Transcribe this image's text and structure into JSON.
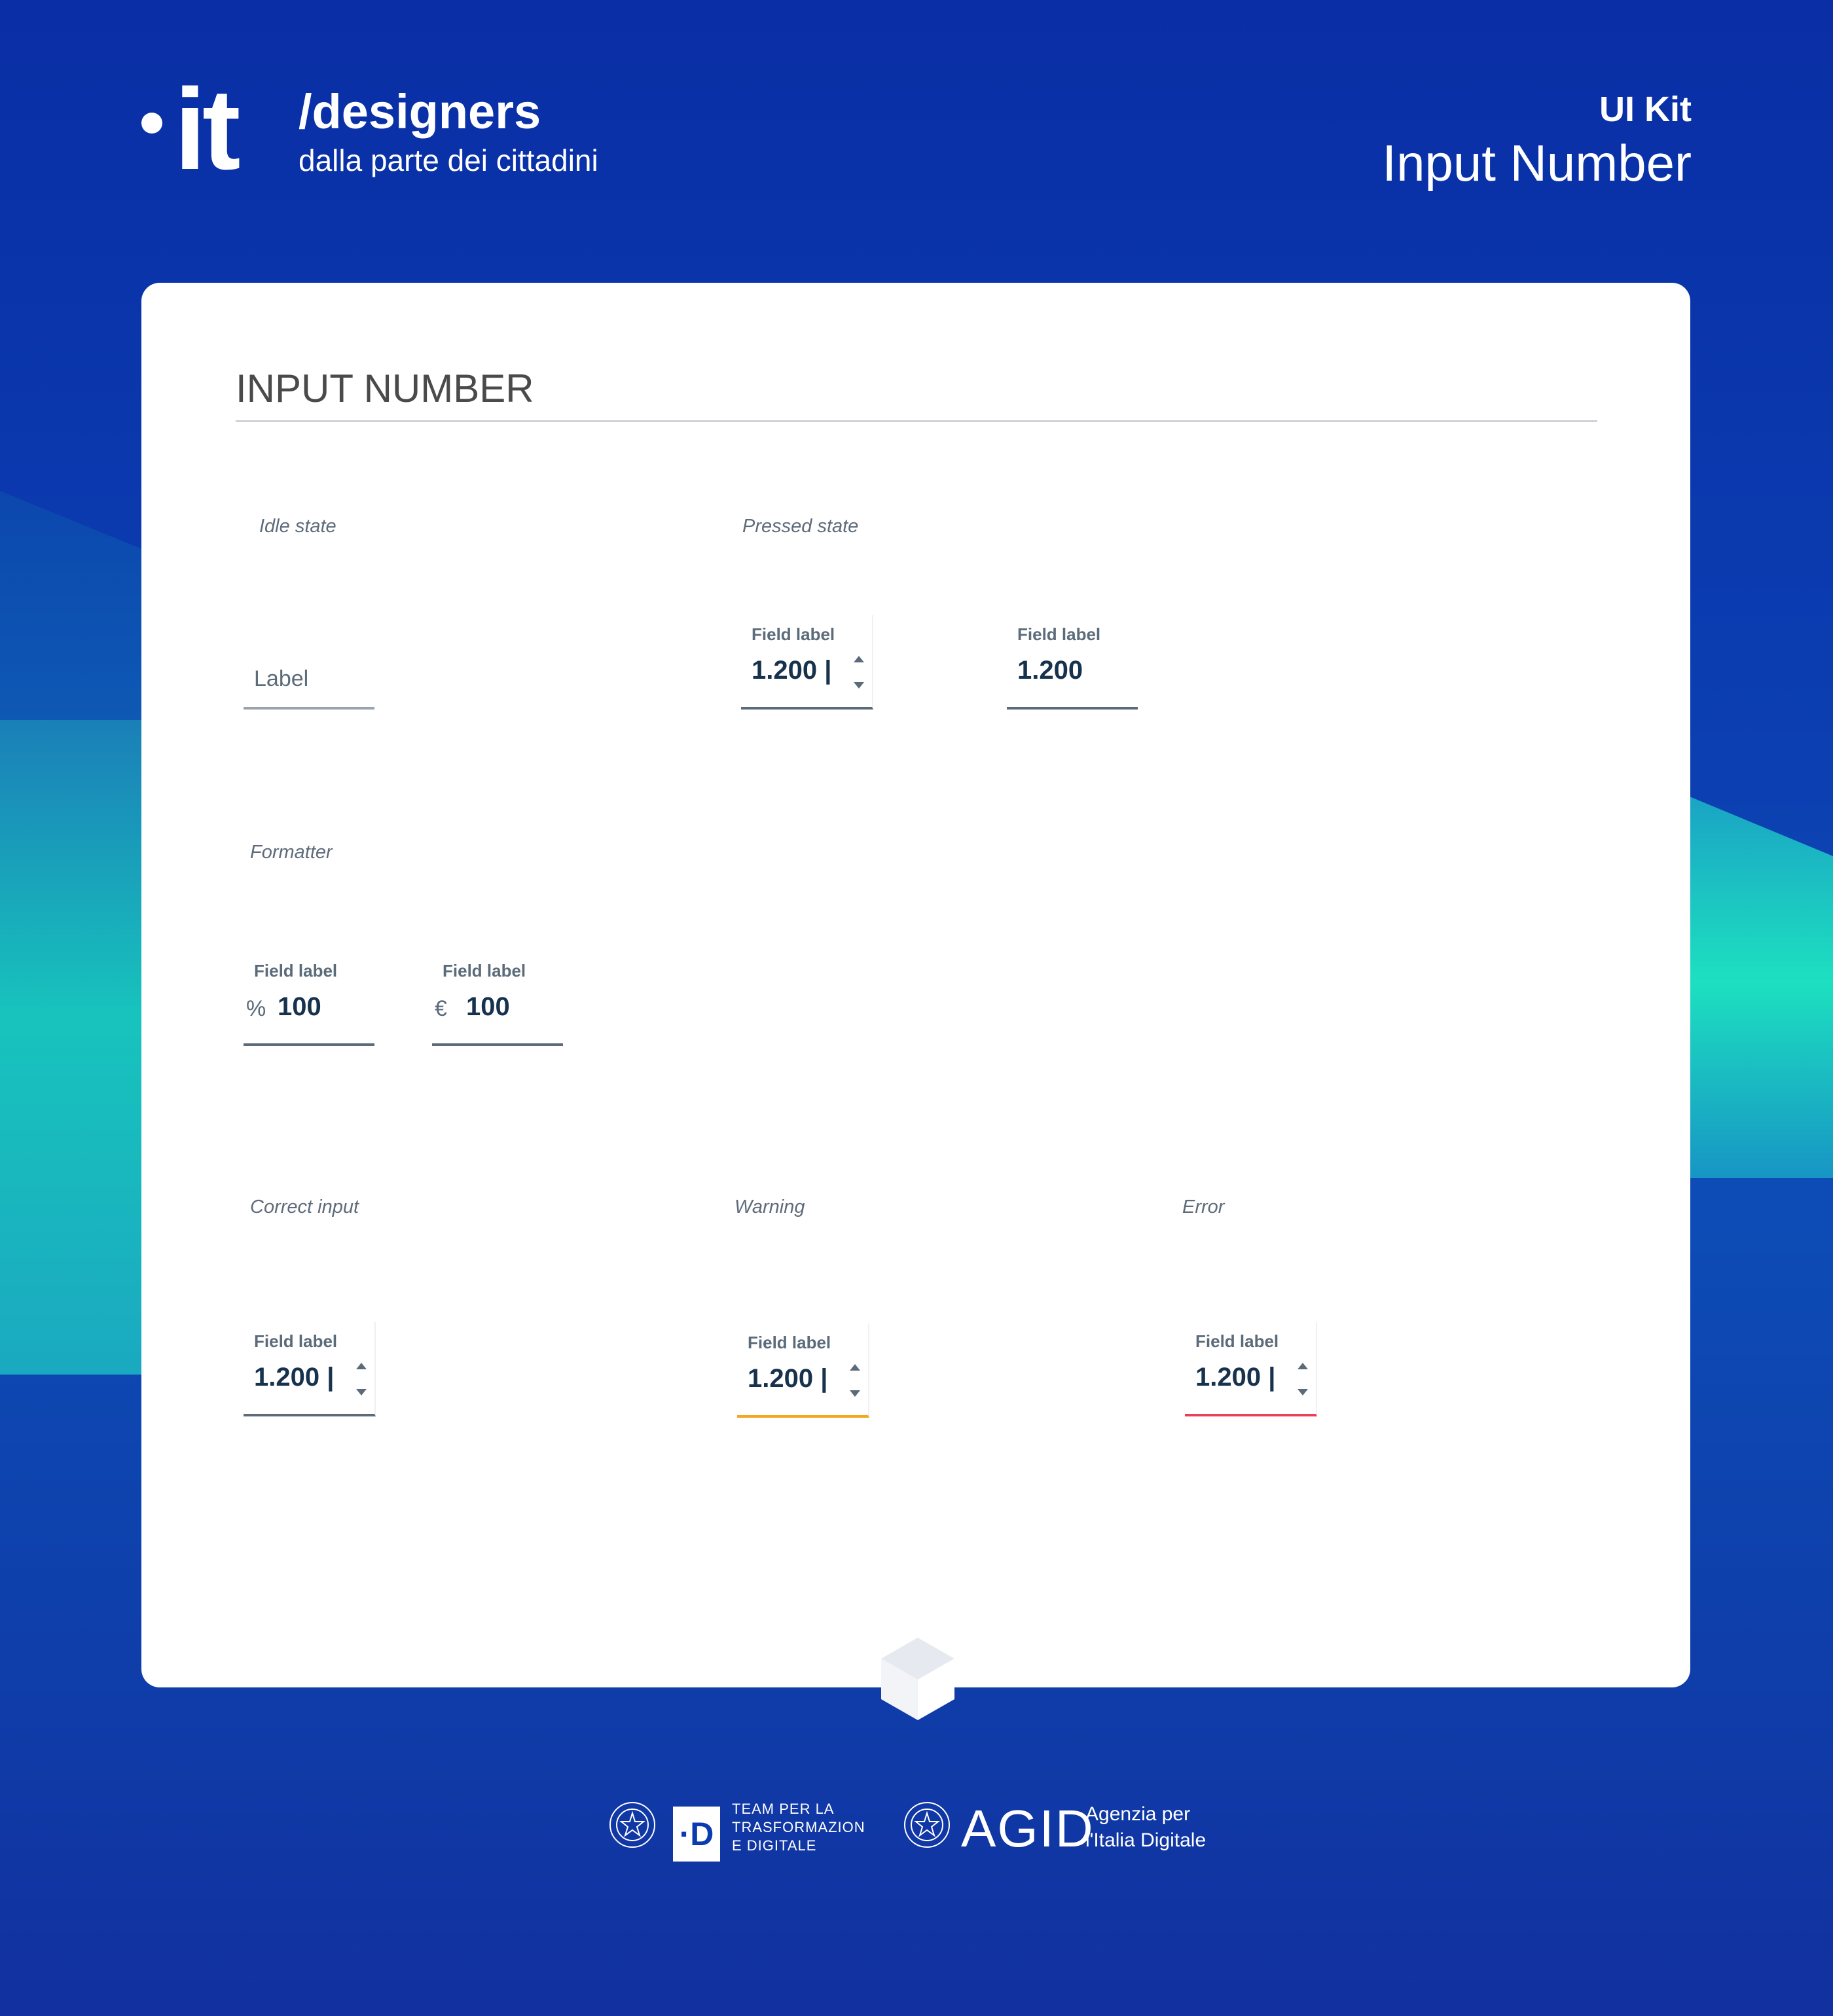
{
  "header": {
    "logo_text": "it",
    "brand_title": "/designers",
    "brand_subtitle": "dalla parte dei cittadini",
    "kit_label": "UI Kit",
    "kit_title": "Input Number"
  },
  "card": {
    "title": "INPUT NUMBER",
    "sections": {
      "idle": "Idle state",
      "pressed": "Pressed state",
      "formatter": "Formatter",
      "correct": "Correct input",
      "warning": "Warning",
      "error": "Error"
    },
    "idle_field": {
      "label": "Label"
    },
    "pressed_field_1": {
      "label": "Field label",
      "value": "1.200 |"
    },
    "pressed_field_2": {
      "label": "Field label",
      "value": "1.200"
    },
    "formatter_percent": {
      "label": "Field label",
      "prefix": "%",
      "value": "100"
    },
    "formatter_euro": {
      "label": "Field label",
      "prefix": "€",
      "value": "100"
    },
    "correct_field": {
      "label": "Field label",
      "value": "1.200 |"
    },
    "warning_field": {
      "label": "Field label",
      "value": "1.200 |"
    },
    "error_field": {
      "label": "Field label",
      "value": "1.200 |"
    }
  },
  "colors": {
    "warning": "#f5a623",
    "error": "#e8405a",
    "default_border": "#5c6b7a",
    "value_text": "#17324d"
  },
  "footer": {
    "team_text": "TEAM PER LA TRASFORMAZION E DIGITALE",
    "team_logo_letter": "·D",
    "agid_name": "AGID",
    "agid_subtitle": "Agenzia per l'Italia Digitale"
  }
}
